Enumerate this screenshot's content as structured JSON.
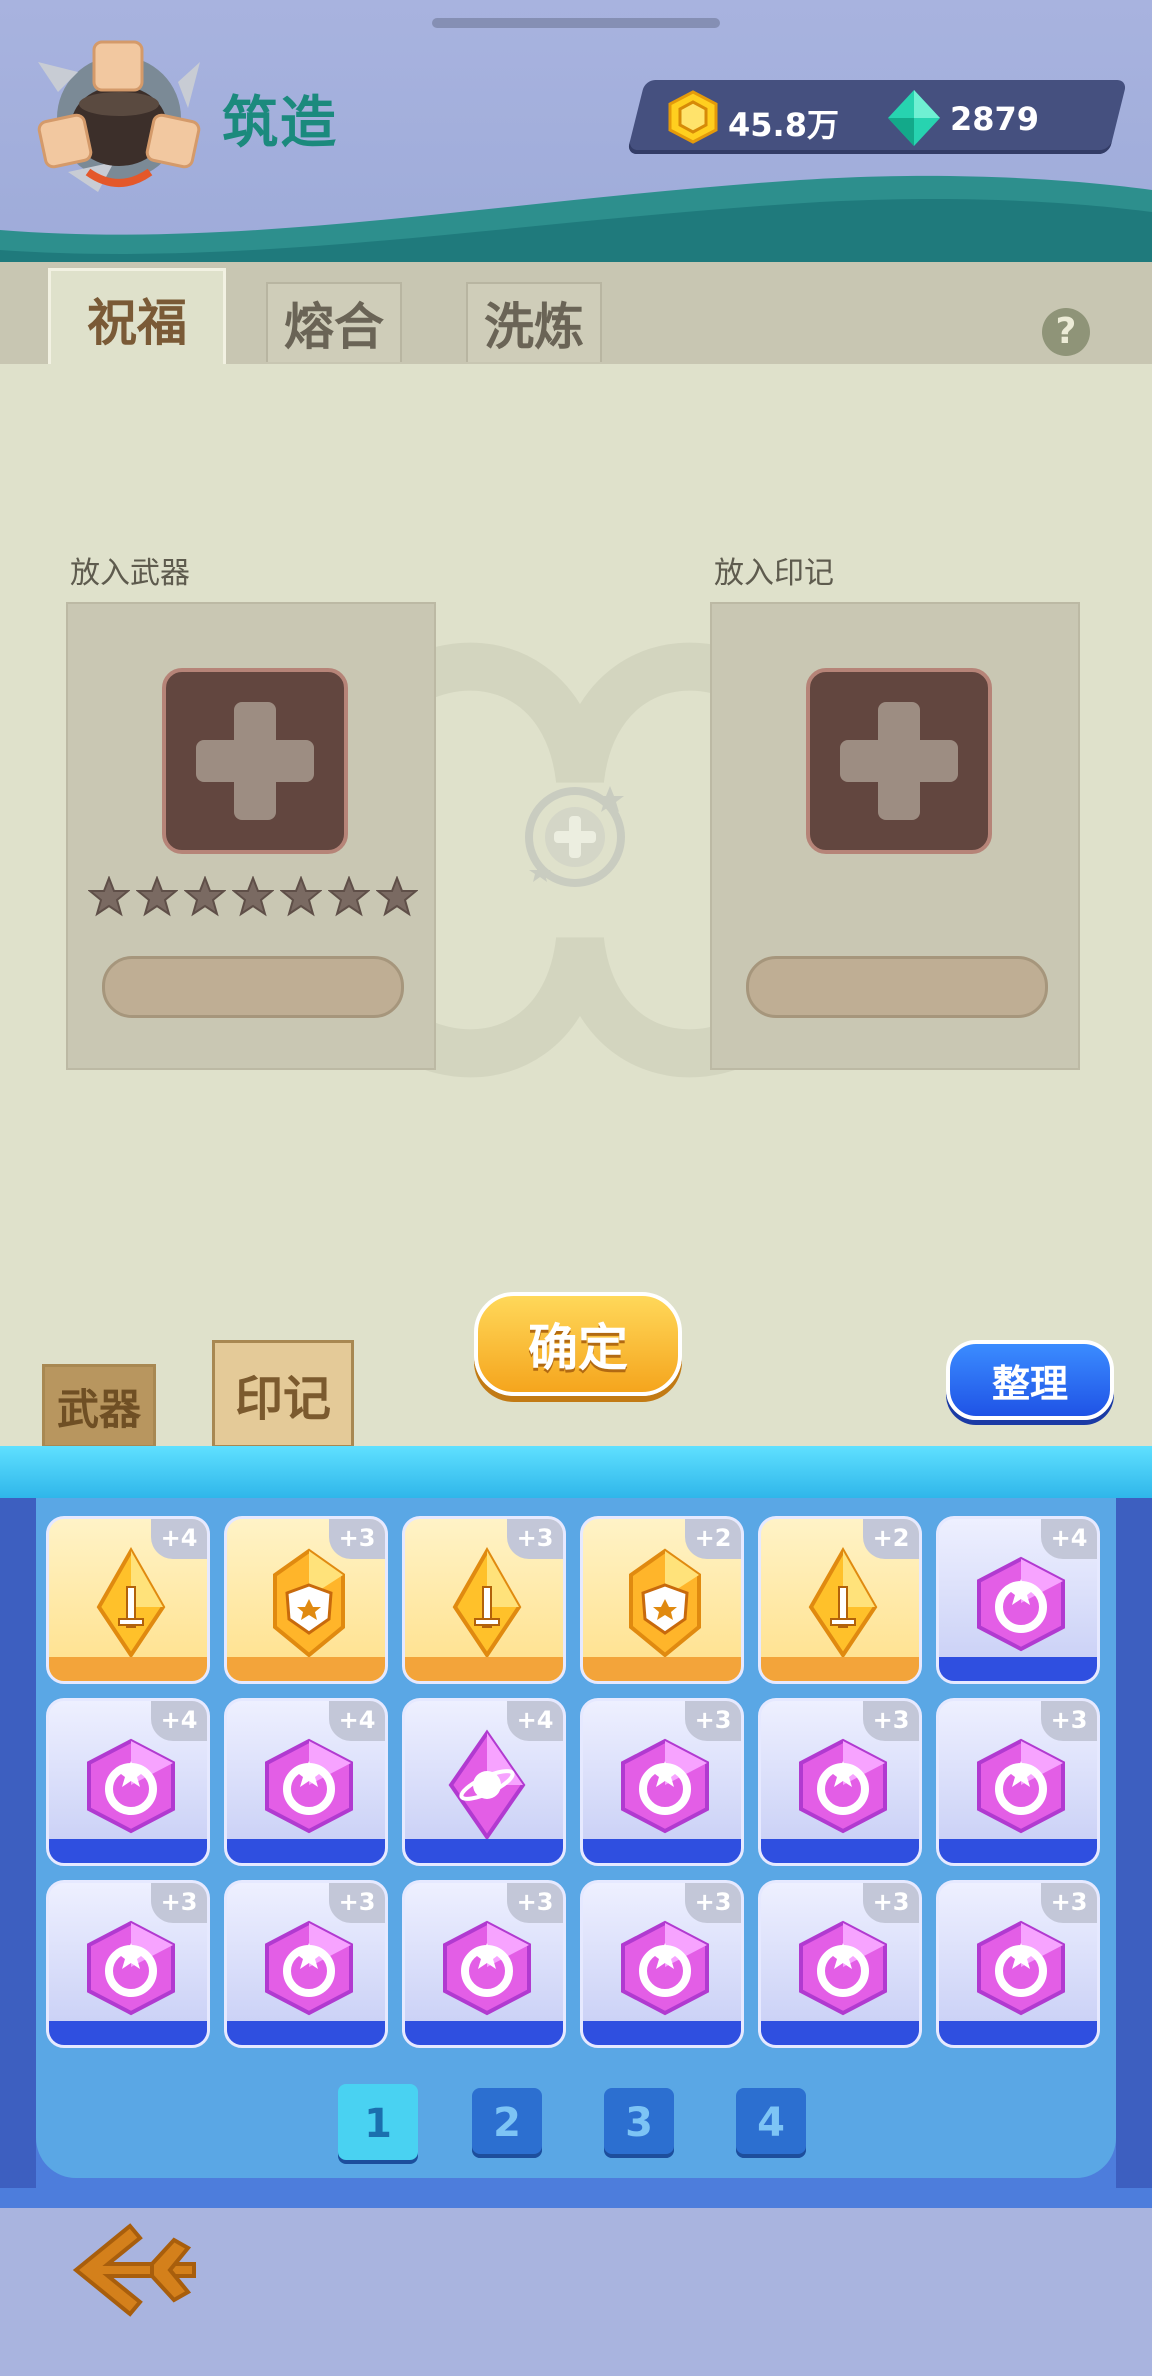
{
  "header": {
    "title": "筑造",
    "gold": "45.8万",
    "gems": "2879",
    "icons": [
      "forge-icon",
      "gold-coin-icon",
      "gem-icon"
    ]
  },
  "tabs": [
    {
      "label": "祝福",
      "active": true
    },
    {
      "label": "熔合",
      "active": false
    },
    {
      "label": "洗炼",
      "active": false
    }
  ],
  "forge": {
    "weapon_label": "放入武器",
    "mark_label": "放入印记",
    "star_count": 7,
    "confirm_label": "确定",
    "sort_label": "整理"
  },
  "bag_tabs": [
    {
      "label": "武器"
    },
    {
      "label": "印记"
    }
  ],
  "inventory": {
    "rows": [
      [
        {
          "type": "gold",
          "icon": "sword-crystal-icon",
          "level": "+4"
        },
        {
          "type": "gold",
          "icon": "shield-crystal-icon",
          "level": "+3"
        },
        {
          "type": "gold",
          "icon": "sword-crystal-icon",
          "level": "+3"
        },
        {
          "type": "gold",
          "icon": "shield-crystal-icon",
          "level": "+2"
        },
        {
          "type": "gold",
          "icon": "sword-crystal-icon",
          "level": "+2"
        },
        {
          "type": "purple",
          "icon": "moon-star-gem-icon",
          "level": "+4"
        }
      ],
      [
        {
          "type": "purple",
          "icon": "moon-star-gem-icon",
          "level": "+4"
        },
        {
          "type": "purple",
          "icon": "moon-star-gem-icon",
          "level": "+4"
        },
        {
          "type": "purple",
          "icon": "planet-gem-icon",
          "level": "+4"
        },
        {
          "type": "purple",
          "icon": "moon-star-gem-icon",
          "level": "+3"
        },
        {
          "type": "purple",
          "icon": "moon-star-gem-icon",
          "level": "+3"
        },
        {
          "type": "purple",
          "icon": "moon-star-gem-icon",
          "level": "+3"
        }
      ],
      [
        {
          "type": "purple",
          "icon": "moon-star-gem-icon",
          "level": "+3"
        },
        {
          "type": "purple",
          "icon": "moon-star-gem-icon",
          "level": "+3"
        },
        {
          "type": "purple",
          "icon": "moon-star-gem-icon",
          "level": "+3"
        },
        {
          "type": "purple",
          "icon": "moon-star-gem-icon",
          "level": "+3"
        },
        {
          "type": "purple",
          "icon": "moon-star-gem-icon",
          "level": "+3"
        },
        {
          "type": "purple",
          "icon": "moon-star-gem-icon",
          "level": "+3"
        }
      ]
    ],
    "pages": [
      "1",
      "2",
      "3",
      "4"
    ],
    "current_page": "1"
  },
  "colors": {
    "title": "#1b8a7d",
    "confirm": "#f5a51d",
    "sort": "#1f53e6",
    "gold_item": "#ffe08a",
    "purple_item": "#c6cdf5"
  }
}
